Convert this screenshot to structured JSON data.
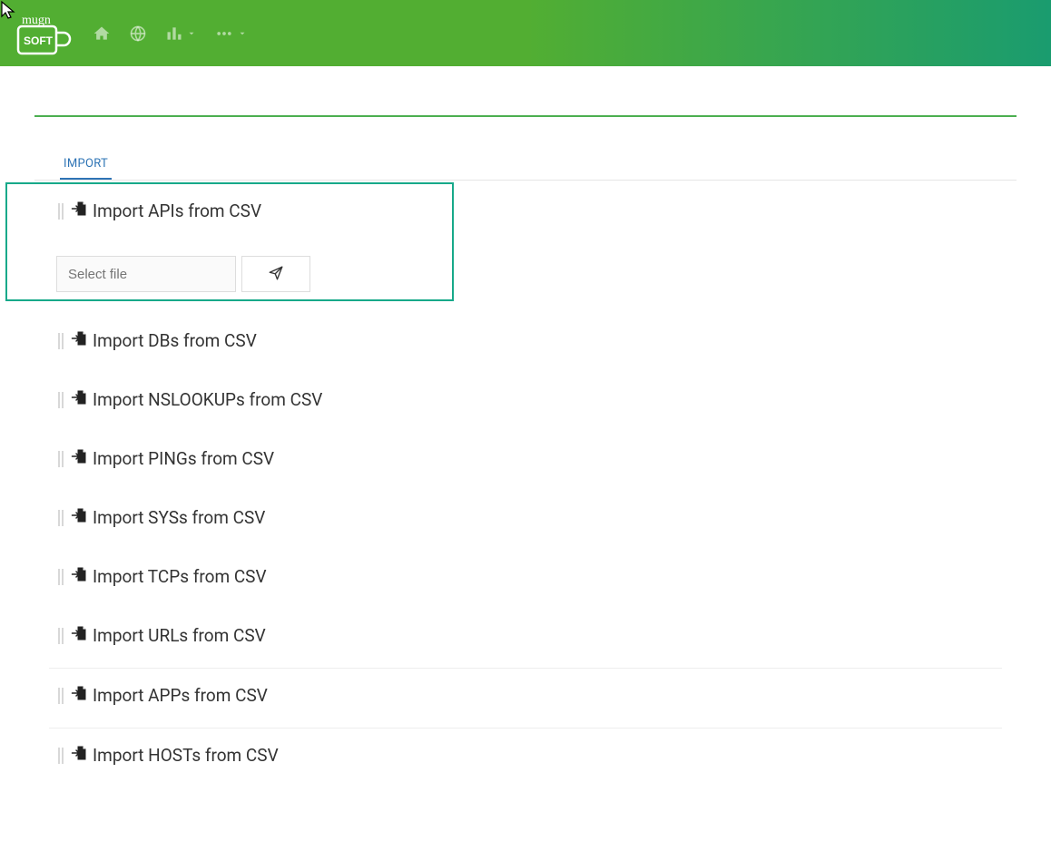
{
  "logo": {
    "line1": "mugn",
    "line2": "SOFT"
  },
  "tabs": {
    "import": "IMPORT"
  },
  "upload": {
    "placeholder": "Select file"
  },
  "panels": [
    {
      "id": "apis",
      "title": "Import APIs from CSV",
      "expanded": true,
      "sep_after": false
    },
    {
      "id": "dbs",
      "title": "Import DBs from CSV",
      "expanded": false,
      "sep_after": false
    },
    {
      "id": "nslookups",
      "title": "Import NSLOOKUPs from CSV",
      "expanded": false,
      "sep_after": false
    },
    {
      "id": "pings",
      "title": "Import PINGs from CSV",
      "expanded": false,
      "sep_after": false
    },
    {
      "id": "syss",
      "title": "Import SYSs from CSV",
      "expanded": false,
      "sep_after": false
    },
    {
      "id": "tcps",
      "title": "Import TCPs from CSV",
      "expanded": false,
      "sep_after": false
    },
    {
      "id": "urls",
      "title": "Import URLs from CSV",
      "expanded": false,
      "sep_after": true
    },
    {
      "id": "apps",
      "title": "Import APPs from CSV",
      "expanded": false,
      "sep_after": true
    },
    {
      "id": "hosts",
      "title": "Import HOSTs from CSV",
      "expanded": false,
      "sep_after": false
    }
  ]
}
